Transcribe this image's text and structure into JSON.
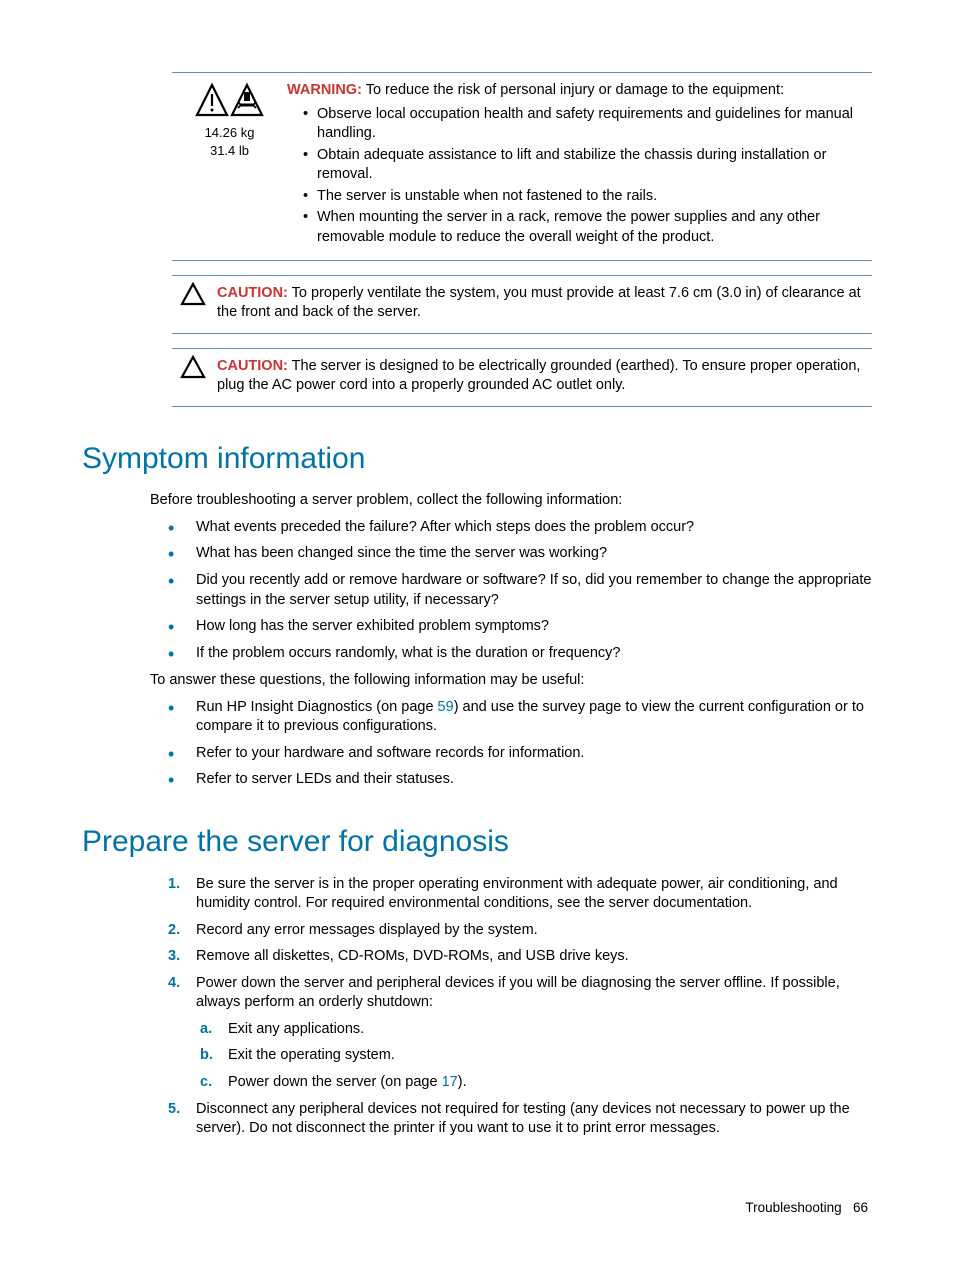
{
  "footer": {
    "section": "Troubleshooting",
    "page": "66"
  },
  "warning": {
    "weight_kg": "14.26 kg",
    "weight_lb": "31.4 lb",
    "label": "WARNING:",
    "text": "To reduce the risk of personal injury or damage to the equipment:",
    "items": [
      "Observe local occupation health and safety requirements and guidelines for manual handling.",
      "Obtain adequate assistance to lift and stabilize the chassis during installation or removal.",
      "The server is unstable when not fastened to the rails.",
      "When mounting the server in a rack, remove the power supplies and any other removable module to reduce the overall weight of the product."
    ]
  },
  "caution1": {
    "label": "CAUTION:",
    "text": "To properly ventilate the system, you must provide at least 7.6 cm (3.0 in) of clearance at the front and back of the server."
  },
  "caution2": {
    "label": "CAUTION:",
    "text": "The server is designed to be electrically grounded (earthed). To ensure proper operation, plug the AC power cord into a properly grounded AC outlet only."
  },
  "symptom": {
    "heading": "Symptom information",
    "intro": "Before troubleshooting a server problem, collect the following information:",
    "questions": [
      "What events preceded the failure? After which steps does the problem occur?",
      "What has been changed since the time the server was working?",
      "Did you recently add or remove hardware or software? If so, did you remember to change the appropriate settings in the server setup utility, if necessary?",
      "How long has the server exhibited problem symptoms?",
      "If the problem occurs randomly, what is the duration or frequency?"
    ],
    "answer_intro": "To answer these questions, the following information may be useful:",
    "answers": {
      "a0_pre": "Run HP Insight Diagnostics (on page ",
      "a0_link": "59",
      "a0_post": ") and use the survey page to view the current configuration or to compare it to previous configurations.",
      "a1": "Refer to your hardware and software records for information.",
      "a2": "Refer to server LEDs and their statuses."
    }
  },
  "prepare": {
    "heading": "Prepare the server for diagnosis",
    "steps": {
      "s1": "Be sure the server is in the proper operating environment with adequate power, air conditioning, and humidity control. For required environmental conditions, see the server documentation.",
      "s2": "Record any error messages displayed by the system.",
      "s3": "Remove all diskettes, CD-ROMs, DVD-ROMs, and USB drive keys.",
      "s4": "Power down the server and peripheral devices if you will be diagnosing the server offline. If possible, always perform an orderly shutdown:",
      "s4a": "Exit any applications.",
      "s4b": "Exit the operating system.",
      "s4c_pre": "Power down the server (on page ",
      "s4c_link": "17",
      "s4c_post": ").",
      "s5": "Disconnect any peripheral devices not required for testing (any devices not necessary to power up the server). Do not disconnect the printer if you want to use it to print error messages."
    }
  }
}
